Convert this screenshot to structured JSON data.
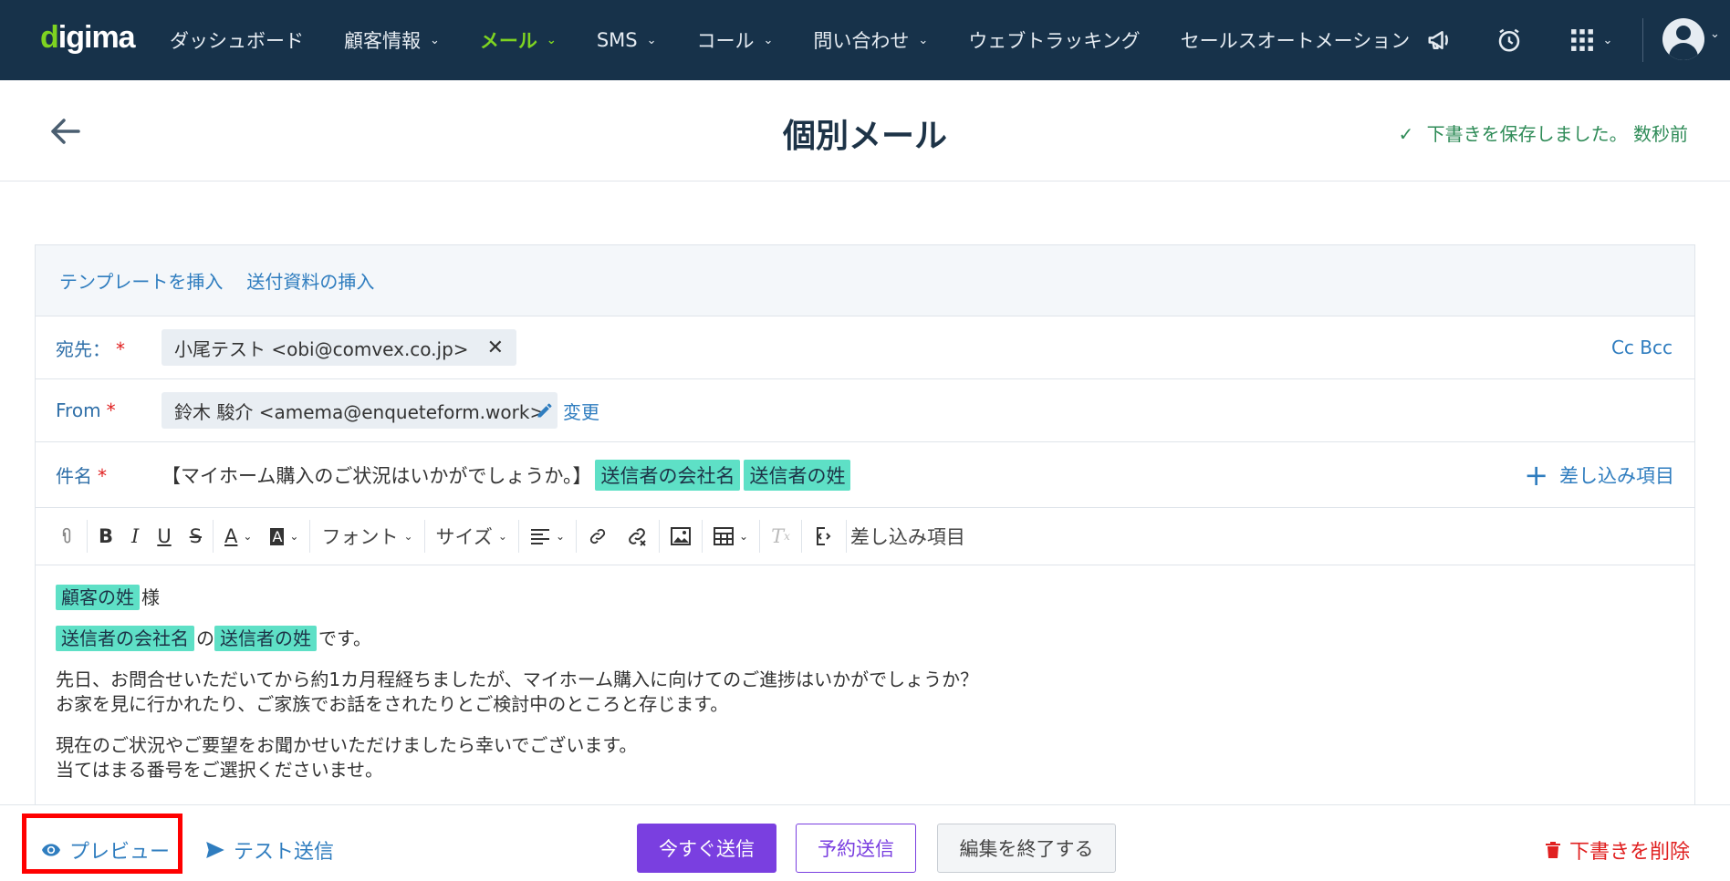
{
  "nav": {
    "logo_prefix": "d",
    "logo_rest": "igima",
    "items": [
      {
        "label": "ダッシュボード",
        "dropdown": false,
        "active": false
      },
      {
        "label": "顧客情報",
        "dropdown": true,
        "active": false
      },
      {
        "label": "メール",
        "dropdown": true,
        "active": true
      },
      {
        "label": "SMS",
        "dropdown": true,
        "active": false
      },
      {
        "label": "コール",
        "dropdown": true,
        "active": false
      },
      {
        "label": "問い合わせ",
        "dropdown": true,
        "active": false
      },
      {
        "label": "ウェブトラッキング",
        "dropdown": false,
        "active": false
      },
      {
        "label": "セールスオートメーション",
        "dropdown": false,
        "active": false
      }
    ],
    "icons": [
      "megaphone-icon",
      "alarm-clock-icon",
      "apps-grid-icon",
      "user-avatar"
    ]
  },
  "header": {
    "title": "個別メール",
    "save_status": "下書きを保存しました。 数秒前"
  },
  "editor": {
    "top_links": [
      "テンプレートを挿入",
      "送付資料の挿入"
    ],
    "to": {
      "label": "宛先：",
      "required": "*",
      "chip": "小尾テスト <obi@comvex.co.jp>",
      "cc_bcc": "Cc Bcc"
    },
    "from": {
      "label": "From",
      "required": "*",
      "chip": "鈴木 駿介 <amema@enqueteform.work>",
      "change": "変更"
    },
    "subject": {
      "label": "件名",
      "required": "*",
      "text": "【マイホーム購入のご状況はいかがでしょうか。】",
      "tags": [
        "送信者の会社名",
        "送信者の姓"
      ],
      "insert_label": "差し込み項目"
    },
    "toolbar": {
      "font": "フォント",
      "size": "サイズ",
      "insert_fields": "差し込み項目"
    },
    "body": {
      "line1_tag": "顧客の姓",
      "line1_suffix": "様",
      "line2_tag1": "送信者の会社名",
      "line2_mid": "の",
      "line2_tag2": "送信者の姓",
      "line2_suffix": "です。",
      "para1_line1": "先日、お問合せいただいてから約1カ月程経ちましたが、マイホーム購入に向けてのご進捗はいかがでしょうか？",
      "para1_line2": "お家を見に行かれたり、ご家族でお話をされたりとご検討中のところと存じます。",
      "para2_line1": "現在のご状況やご要望をお聞かせいただけましたら幸いでございます。",
      "para2_line2": "当てはまる番号をご選択くださいませ。"
    }
  },
  "footer": {
    "preview": "プレビュー",
    "test_send": "テスト送信",
    "send_now": "今すぐ送信",
    "schedule": "予約送信",
    "end_edit": "編集を終了する",
    "delete_draft": "下書きを削除"
  },
  "colors": {
    "nav_bg": "#17324a",
    "accent_green": "#7ed321",
    "link_blue": "#2f7dbf",
    "tag_bg": "#5ee0c6",
    "primary_purple": "#7a3fe0",
    "danger_red": "#e02020",
    "highlight_box": "#ff0000"
  }
}
